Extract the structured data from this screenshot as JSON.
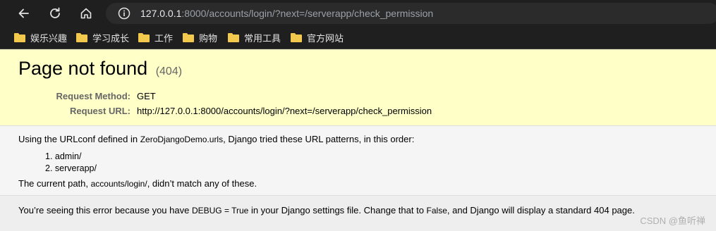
{
  "browser": {
    "url_host": "127.0.0.1",
    "url_rest": ":8000/accounts/login/?next=/serverapp/check_permission",
    "bookmarks": [
      "娱乐兴趣",
      "学习成长",
      "工作",
      "购物",
      "常用工具",
      "官方网站"
    ]
  },
  "page": {
    "title": "Page not found",
    "status_code": "(404)",
    "request_method_label": "Request Method:",
    "request_method_value": "GET",
    "request_url_label": "Request URL:",
    "request_url_value": "http://127.0.0.1:8000/accounts/login/?next=/serverapp/check_permission",
    "urlconf_prefix": "Using the URLconf defined in ",
    "urlconf_name": "ZeroDjangoDemo.urls",
    "urlconf_suffix": ", Django tried these URL patterns, in this order:",
    "patterns": [
      "1. admin/",
      "2. serverapp/"
    ],
    "current_path_prefix": "The current path, ",
    "current_path": "accounts/login/",
    "current_path_suffix": ", didn’t match any of these.",
    "debug_prefix": "You’re seeing this error because you have ",
    "debug_setting": "DEBUG = True",
    "debug_middle": " in your Django settings file. Change that to ",
    "debug_false": "False",
    "debug_suffix": ", and Django will display a standard 404 page."
  },
  "watermark": "CSDN @鱼听禅",
  "colors": {
    "chrome_bg": "#1f1f1f",
    "omnibox_bg": "#2b2b2b",
    "summary_bg": "#ffffc8",
    "folder": "#f2c94c"
  }
}
